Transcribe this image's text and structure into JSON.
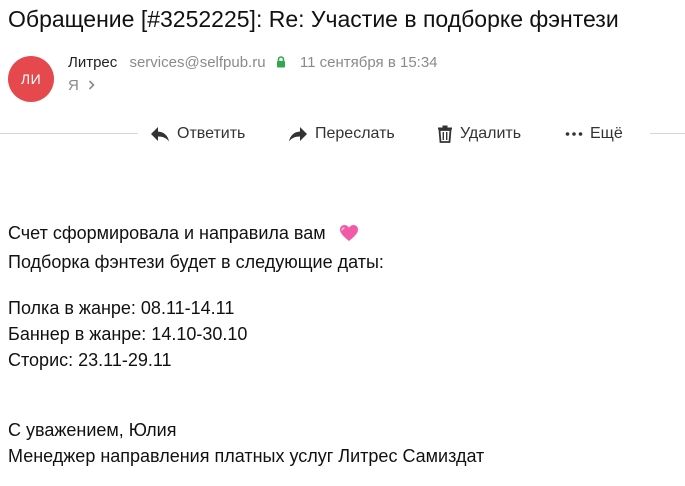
{
  "email": {
    "subject": "Обращение [#3252225]: Re: Участие в подборке фэнтези",
    "sender": {
      "avatar_initials": "ЛИ",
      "avatar_color": "#e5484d",
      "name": "Литрес",
      "email": "services@selfpub.ru",
      "date": "11 сентября в 15:34"
    },
    "recipient": "Я",
    "icons": {
      "secure": "lock-icon",
      "recipient_expand": "chevron-right-icon",
      "emoji": "heart-emoji-icon"
    },
    "body": {
      "line1": "Счет сформировала и направила вам",
      "line2": "Подборка фэнтези будет в следующие даты:",
      "line3": "Полка в жанре: 08.11-14.11",
      "line4": "Баннер в жанре: 14.10-30.10",
      "line5": "Сторис: 23.11-29.11",
      "signature1": "С уважением, Юлия",
      "signature2": "Менеджер направления платных услуг Литрес Самиздат"
    }
  },
  "toolbar": {
    "reply_label": "Ответить",
    "forward_label": "Переслать",
    "delete_label": "Удалить",
    "more_label": "Ещё",
    "icons": [
      "reply-icon",
      "forward-icon",
      "trash-icon",
      "more-dots-icon"
    ]
  },
  "colors": {
    "lock_green": "#2fa84f",
    "heart_pink": "#f25aa7",
    "muted_text": "#8a8a8a"
  }
}
